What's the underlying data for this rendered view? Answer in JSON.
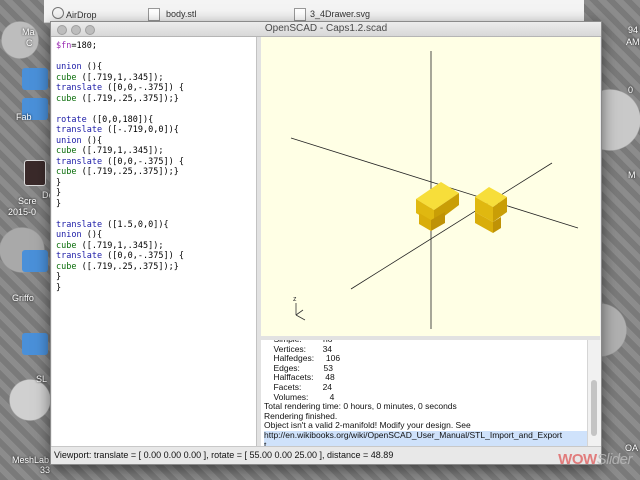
{
  "desktop": {
    "labels": [
      "Ma",
      "C",
      "Fab",
      "De",
      "Scre",
      "2015-0",
      "Griffo",
      "SL",
      "MeshLab",
      "33",
      "94",
      "AM",
      "0",
      "M",
      "OA"
    ]
  },
  "finder": {
    "sidebar_item": "AirDrop",
    "file1": "body.stl",
    "file2": "3_4Drawer.svg"
  },
  "window": {
    "title": "OpenSCAD - Caps1.2.scad"
  },
  "editor": {
    "lines": [
      "$fn=180;",
      "",
      "union (){",
      "cube ([.719,1,.345]);",
      "translate ([0,0,-.375]) {",
      "cube ([.719,.25,.375]);}",
      "",
      "rotate ([0,0,180]){",
      "translate ([-.719,0,0]){",
      "union (){",
      "cube ([.719,1,.345]);",
      "translate ([0,0,-.375]) {",
      "cube ([.719,.25,.375]);}",
      "}",
      "}",
      "}",
      "",
      "translate ([1.5,0,0]){",
      "union (){",
      "cube ([.719,1,.345]);",
      "translate ([0,0,-.375]) {",
      "cube ([.719,.25,.375]);}",
      "}",
      "}"
    ]
  },
  "viewport": {
    "axis_label": "z",
    "background": "#ffffe5",
    "model_color": "#f5d21f"
  },
  "console": {
    "lines": [
      "    Simple:         no",
      "    Vertices:       34",
      "    Halfedges:     106",
      "    Edges:          53",
      "    Halffacets:     48",
      "    Facets:         24",
      "    Volumes:         4",
      "Total rendering time: 0 hours, 0 minutes, 0 seconds",
      "Rendering finished.",
      "Object isn't a valid 2-manifold! Modify your design. See",
      "http://en.wikibooks.org/wiki/OpenSCAD_User_Manual/STL_Import_and_Export",
      "t"
    ]
  },
  "statusbar": {
    "text": "Viewport: translate = [ 0.00 0.00 0.00 ], rotate = [ 55.00 0.00 25.00 ], distance = 48.89"
  },
  "watermark": {
    "part1": "WOW",
    "part2": "Slider"
  }
}
